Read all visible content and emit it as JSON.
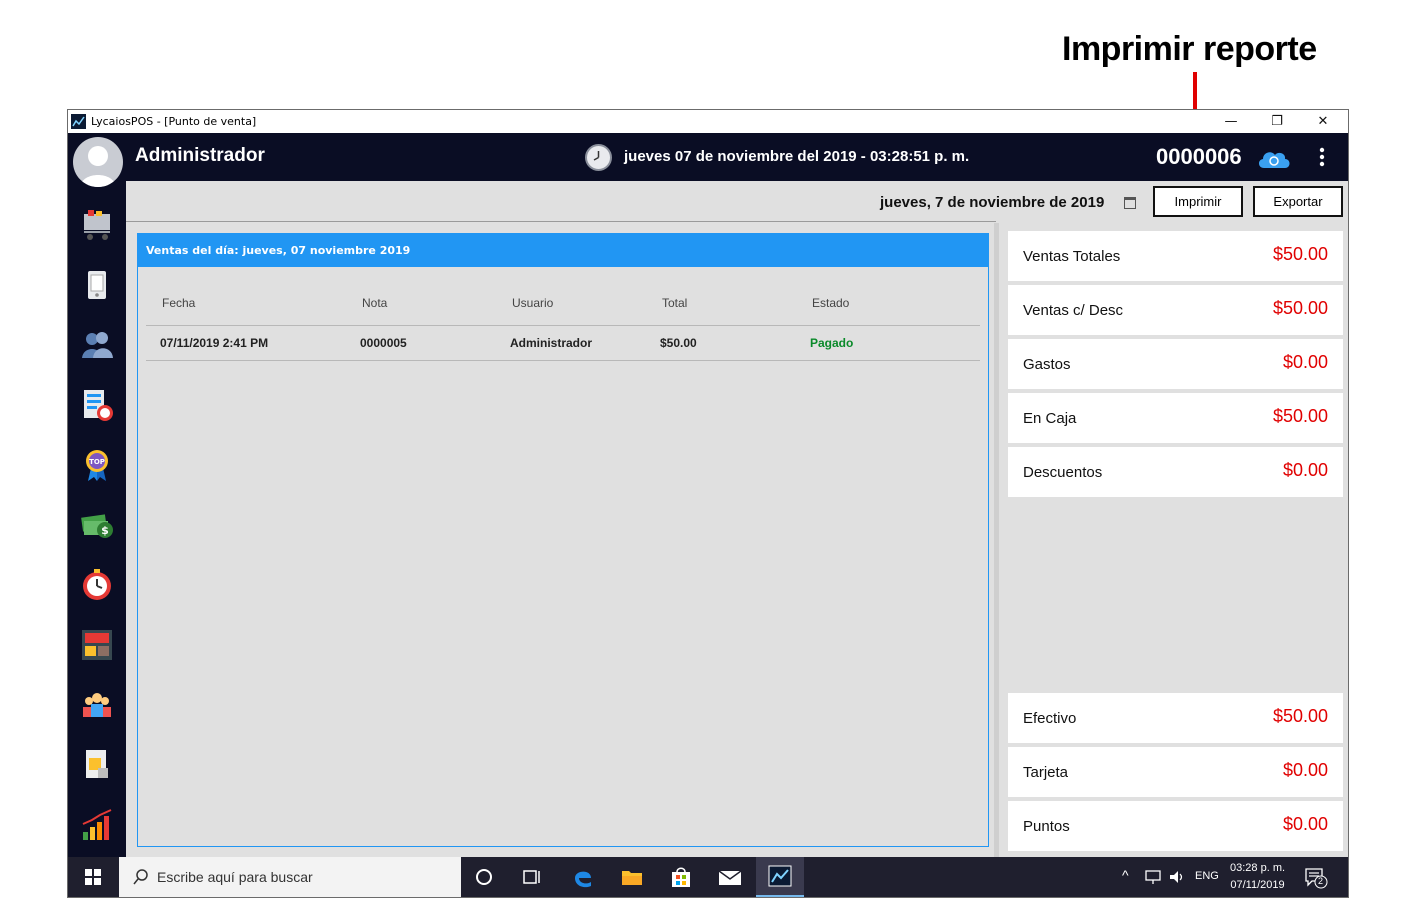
{
  "annotation": {
    "title": "Imprimir reporte"
  },
  "window": {
    "title": "LycaiosPOS - [Punto de venta]"
  },
  "header": {
    "user": "Administrador",
    "datetime": "jueves 07 de noviembre del 2019 - 03:28:51 p. m.",
    "folio": "0000006"
  },
  "toolbar": {
    "report_date": "jueves, 7 de noviembre de 2019",
    "print_label": "Imprimir",
    "export_label": "Exportar"
  },
  "sales_panel": {
    "title": "Ventas del día:  jueves, 07 noviembre 2019",
    "columns": [
      "Fecha",
      "Nota",
      "Usuario",
      "Total",
      "Estado"
    ],
    "rows": [
      {
        "fecha": "07/11/2019 2:41 PM",
        "nota": "0000005",
        "usuario": "Administrador",
        "total": "$50.00",
        "estado": "Pagado"
      }
    ]
  },
  "summary": [
    {
      "label": "Ventas Totales",
      "value": "$50.00"
    },
    {
      "label": "Ventas c/ Desc",
      "value": "$50.00"
    },
    {
      "label": "Gastos",
      "value": "$0.00"
    },
    {
      "label": "En Caja",
      "value": "$50.00"
    },
    {
      "label": "Descuentos",
      "value": "$0.00"
    }
  ],
  "payment_summary": [
    {
      "label": "Efectivo",
      "value": "$50.00"
    },
    {
      "label": "Tarjeta",
      "value": "$0.00"
    },
    {
      "label": "Puntos",
      "value": "$0.00"
    }
  ],
  "sidebar": {
    "icons": [
      "cart-icon",
      "phone-icon",
      "users-icon",
      "report-clock-icon",
      "top-badge-icon",
      "money-icon",
      "alarm-icon",
      "inventory-icon",
      "employees-icon",
      "document-icon",
      "growth-chart-icon"
    ]
  },
  "taskbar": {
    "search_placeholder": "Escribe aquí para buscar",
    "language": "ENG",
    "time": "03:28 p. m.",
    "date": "07/11/2019",
    "notifications": "2"
  },
  "colors": {
    "accent": "#2196f3",
    "header_bg": "#0a0d24",
    "value_red": "#e00000",
    "status_green": "#0a8a2a"
  }
}
